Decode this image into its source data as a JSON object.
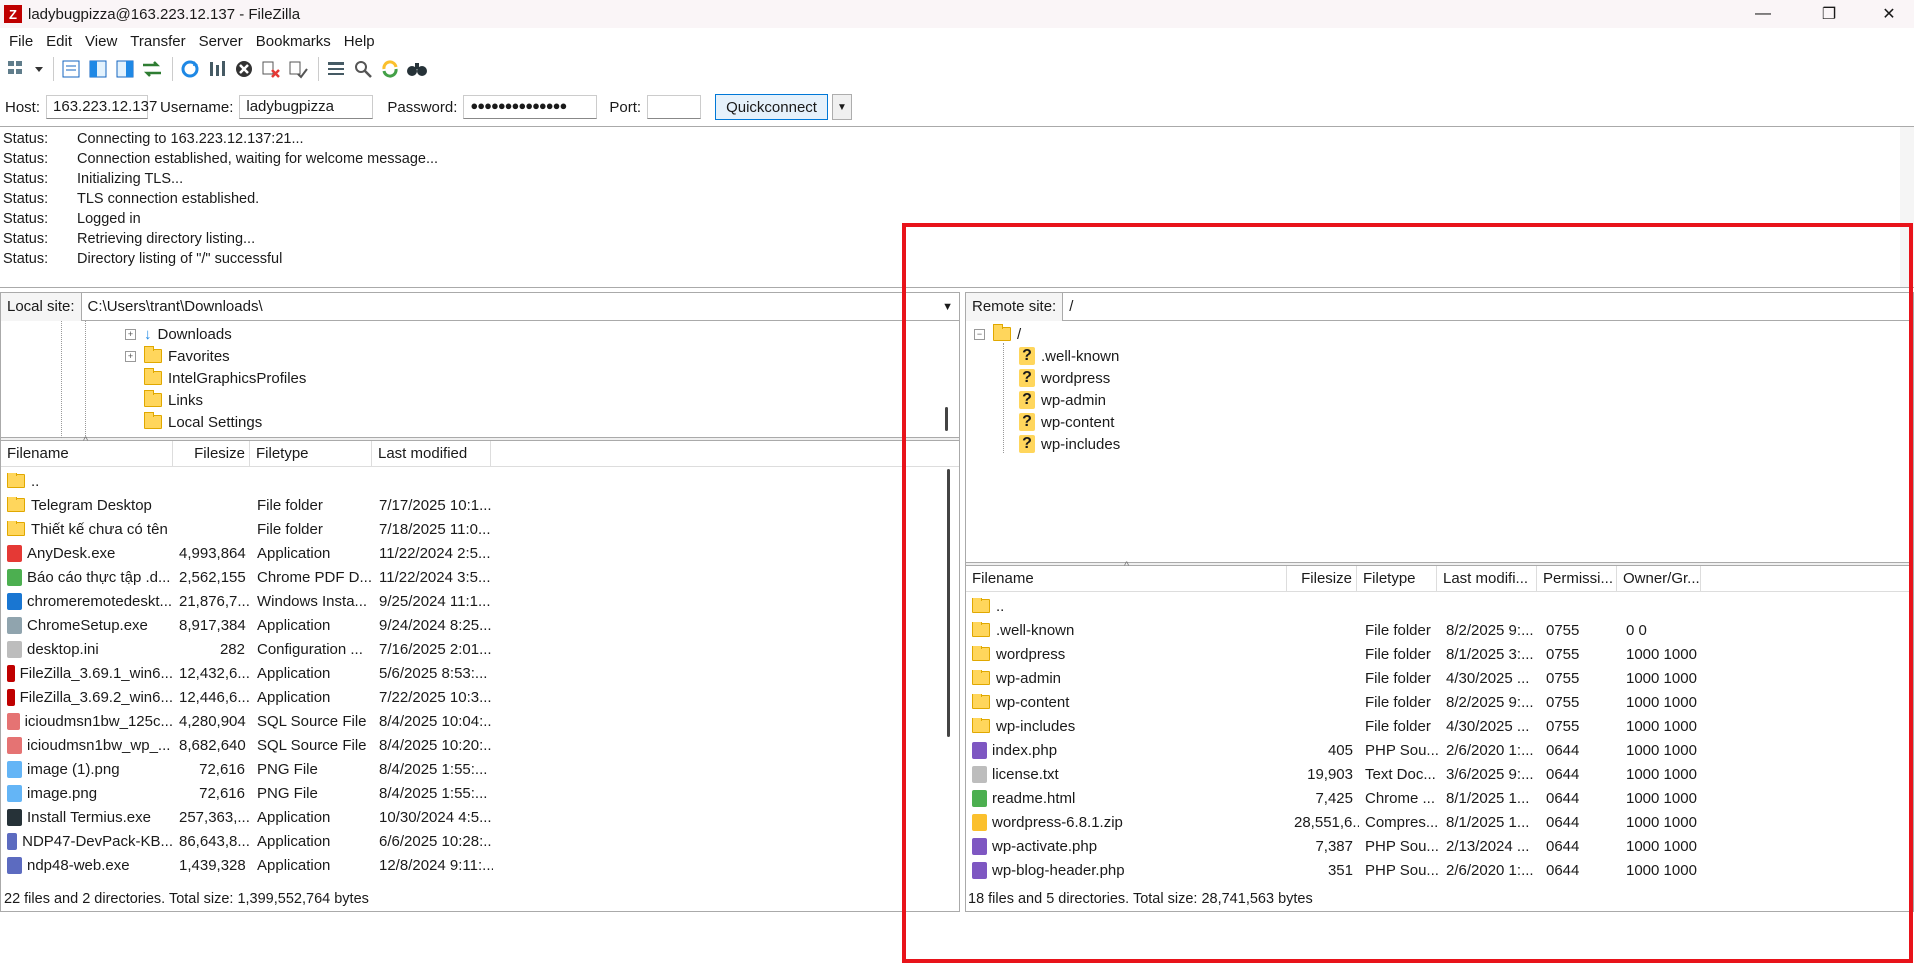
{
  "window": {
    "title": "ladybugpizza@163.223.12.137 - FileZilla",
    "minimize": "—",
    "maximize": "❐",
    "close": "✕"
  },
  "menu": [
    "File",
    "Edit",
    "View",
    "Transfer",
    "Server",
    "Bookmarks",
    "Help"
  ],
  "quickconnect": {
    "host_label": "Host:",
    "host": "163.223.12.137",
    "username_label": "Username:",
    "username": "ladybugpizza",
    "password_label": "Password:",
    "password": "●●●●●●●●●●●●●●",
    "port_label": "Port:",
    "port": "",
    "button": "Quickconnect"
  },
  "log": [
    {
      "k": "Status:",
      "v": "Connecting to 163.223.12.137:21..."
    },
    {
      "k": "Status:",
      "v": "Connection established, waiting for welcome message..."
    },
    {
      "k": "Status:",
      "v": "Initializing TLS..."
    },
    {
      "k": "Status:",
      "v": "TLS connection established."
    },
    {
      "k": "Status:",
      "v": "Logged in"
    },
    {
      "k": "Status:",
      "v": "Retrieving directory listing..."
    },
    {
      "k": "Status:",
      "v": "Directory listing of \"/\" successful"
    }
  ],
  "local": {
    "label": "Local site:",
    "path": "C:\\Users\\trant\\Downloads\\",
    "tree": [
      "Downloads",
      "Favorites",
      "IntelGraphicsProfiles",
      "Links",
      "Local Settings"
    ],
    "headers": [
      "Filename",
      "Filesize",
      "Filetype",
      "Last modified"
    ],
    "files": [
      {
        "name": "..",
        "size": "",
        "type": "",
        "mod": "",
        "icon": "folder"
      },
      {
        "name": "Telegram Desktop",
        "size": "",
        "type": "File folder",
        "mod": "7/17/2025 10:1...",
        "icon": "folder"
      },
      {
        "name": "Thiết kế chưa có tên",
        "size": "",
        "type": "File folder",
        "mod": "7/18/2025 11:0...",
        "icon": "folder"
      },
      {
        "name": "AnyDesk.exe",
        "size": "4,993,864",
        "type": "Application",
        "mod": "11/22/2024 2:5...",
        "icon": "#e53935"
      },
      {
        "name": "Báo cáo thực tập .d...",
        "size": "2,562,155",
        "type": "Chrome PDF D...",
        "mod": "11/22/2024 3:5...",
        "icon": "#4caf50"
      },
      {
        "name": "chromeremotedeskt...",
        "size": "21,876,7...",
        "type": "Windows Insta...",
        "mod": "9/25/2024 11:1...",
        "icon": "#1976d2"
      },
      {
        "name": "ChromeSetup.exe",
        "size": "8,917,384",
        "type": "Application",
        "mod": "9/24/2024 8:25...",
        "icon": "#90a4ae"
      },
      {
        "name": "desktop.ini",
        "size": "282",
        "type": "Configuration ...",
        "mod": "7/16/2025 2:01...",
        "icon": "#bdbdbd"
      },
      {
        "name": "FileZilla_3.69.1_win6...",
        "size": "12,432,6...",
        "type": "Application",
        "mod": "5/6/2025 8:53:...",
        "icon": "#bf0000"
      },
      {
        "name": "FileZilla_3.69.2_win6...",
        "size": "12,446,6...",
        "type": "Application",
        "mod": "7/22/2025 10:3...",
        "icon": "#bf0000"
      },
      {
        "name": "icioudmsn1bw_125c...",
        "size": "4,280,904",
        "type": "SQL Source File",
        "mod": "8/4/2025 10:04:...",
        "icon": "#e57373"
      },
      {
        "name": "icioudmsn1bw_wp_...",
        "size": "8,682,640",
        "type": "SQL Source File",
        "mod": "8/4/2025 10:20:...",
        "icon": "#e57373"
      },
      {
        "name": "image (1).png",
        "size": "72,616",
        "type": "PNG File",
        "mod": "8/4/2025 1:55:...",
        "icon": "#64b5f6"
      },
      {
        "name": "image.png",
        "size": "72,616",
        "type": "PNG File",
        "mod": "8/4/2025 1:55:...",
        "icon": "#64b5f6"
      },
      {
        "name": "Install Termius.exe",
        "size": "257,363,...",
        "type": "Application",
        "mod": "10/30/2024 4:5...",
        "icon": "#263238"
      },
      {
        "name": "NDP47-DevPack-KB...",
        "size": "86,643,8...",
        "type": "Application",
        "mod": "6/6/2025 10:28:...",
        "icon": "#5c6bc0"
      },
      {
        "name": "ndp48-web.exe",
        "size": "1,439,328",
        "type": "Application",
        "mod": "12/8/2024 9:11:...",
        "icon": "#5c6bc0"
      }
    ],
    "status": "22 files and 2 directories. Total size: 1,399,552,764 bytes"
  },
  "remote": {
    "label": "Remote site:",
    "path": "/",
    "tree_root": "/",
    "tree": [
      ".well-known",
      "wordpress",
      "wp-admin",
      "wp-content",
      "wp-includes"
    ],
    "headers": [
      "Filename",
      "Filesize",
      "Filetype",
      "Last modifi...",
      "Permissi...",
      "Owner/Gr..."
    ],
    "files": [
      {
        "name": "..",
        "size": "",
        "type": "",
        "mod": "",
        "perm": "",
        "owner": "",
        "icon": "folder"
      },
      {
        "name": ".well-known",
        "size": "",
        "type": "File folder",
        "mod": "8/2/2025 9:...",
        "perm": "0755",
        "owner": "0 0",
        "icon": "folder"
      },
      {
        "name": "wordpress",
        "size": "",
        "type": "File folder",
        "mod": "8/1/2025 3:...",
        "perm": "0755",
        "owner": "1000 1000",
        "icon": "folder"
      },
      {
        "name": "wp-admin",
        "size": "",
        "type": "File folder",
        "mod": "4/30/2025 ...",
        "perm": "0755",
        "owner": "1000 1000",
        "icon": "folder"
      },
      {
        "name": "wp-content",
        "size": "",
        "type": "File folder",
        "mod": "8/2/2025 9:...",
        "perm": "0755",
        "owner": "1000 1000",
        "icon": "folder"
      },
      {
        "name": "wp-includes",
        "size": "",
        "type": "File folder",
        "mod": "4/30/2025 ...",
        "perm": "0755",
        "owner": "1000 1000",
        "icon": "folder"
      },
      {
        "name": "index.php",
        "size": "405",
        "type": "PHP Sou...",
        "mod": "2/6/2020 1:...",
        "perm": "0644",
        "owner": "1000 1000",
        "icon": "#7e57c2"
      },
      {
        "name": "license.txt",
        "size": "19,903",
        "type": "Text Doc...",
        "mod": "3/6/2025 9:...",
        "perm": "0644",
        "owner": "1000 1000",
        "icon": "#bdbdbd"
      },
      {
        "name": "readme.html",
        "size": "7,425",
        "type": "Chrome ...",
        "mod": "8/1/2025 1...",
        "perm": "0644",
        "owner": "1000 1000",
        "icon": "#4caf50"
      },
      {
        "name": "wordpress-6.8.1.zip",
        "size": "28,551,6...",
        "type": "Compres...",
        "mod": "8/1/2025 1...",
        "perm": "0644",
        "owner": "1000 1000",
        "icon": "#fbc02d"
      },
      {
        "name": "wp-activate.php",
        "size": "7,387",
        "type": "PHP Sou...",
        "mod": "2/13/2024 ...",
        "perm": "0644",
        "owner": "1000 1000",
        "icon": "#7e57c2"
      },
      {
        "name": "wp-blog-header.php",
        "size": "351",
        "type": "PHP Sou...",
        "mod": "2/6/2020 1:...",
        "perm": "0644",
        "owner": "1000 1000",
        "icon": "#7e57c2"
      }
    ],
    "status": "18 files and 5 directories. Total size: 28,741,563 bytes"
  }
}
